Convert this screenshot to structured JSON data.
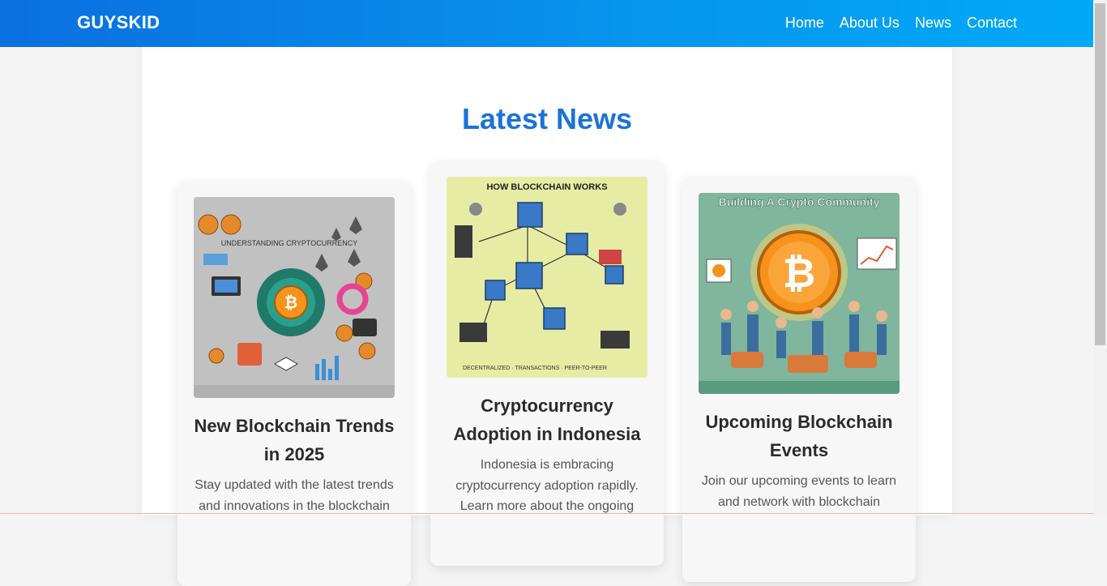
{
  "nav": {
    "brand": "GUYSKID",
    "links": [
      {
        "label": "Home"
      },
      {
        "label": "About Us"
      },
      {
        "label": "News"
      },
      {
        "label": "Contact"
      }
    ]
  },
  "news": {
    "title": "Latest News",
    "cards": [
      {
        "image_alt": "cryptocurrency infographic",
        "image_text": "UNDERSTANDING CRYPTOCURRENCY",
        "title": "New Blockchain Trends in 2025",
        "text": "Stay updated with the latest trends and innovations in the blockchain"
      },
      {
        "image_alt": "blockchain diagram",
        "image_text": "HOW BLOCKCHAIN WORKS",
        "title": "Cryptocurrency Adoption in Indonesia",
        "text": "Indonesia is embracing cryptocurrency adoption rapidly. Learn more about the ongoing"
      },
      {
        "image_alt": "crypto community illustration",
        "image_text": "Building A Crypto Community",
        "title": "Upcoming Blockchain Events",
        "text": "Join our upcoming events to learn and network with blockchain"
      }
    ]
  },
  "colors": {
    "nav_start": "#0a6fe0",
    "nav_end": "#00a9f6",
    "title": "#1a73d9",
    "bitcoin": "#f7931a"
  }
}
